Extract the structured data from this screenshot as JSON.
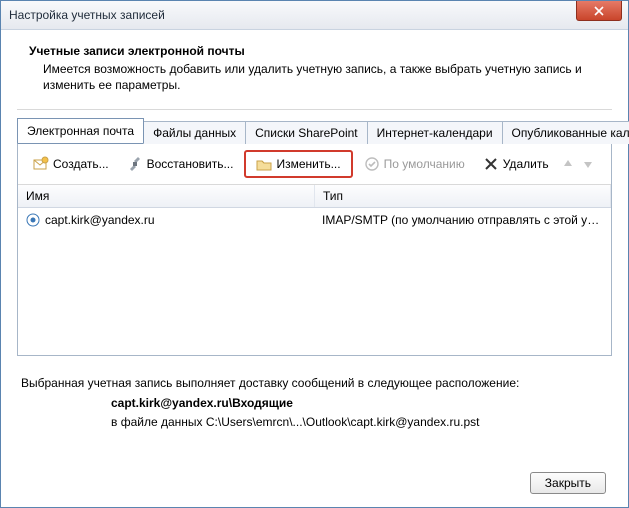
{
  "window": {
    "title": "Настройка учетных записей"
  },
  "header": {
    "title": "Учетные записи электронной почты",
    "description": "Имеется возможность добавить или удалить учетную запись, а также выбрать учетную запись и изменить ее параметры."
  },
  "tabs": [
    {
      "label": "Электронная почта",
      "active": true
    },
    {
      "label": "Файлы данных"
    },
    {
      "label": "Списки SharePoint"
    },
    {
      "label": "Интернет-календари"
    },
    {
      "label": "Опубликованные календари"
    }
  ],
  "toolbar": {
    "create": "Создать...",
    "restore": "Восстановить...",
    "edit": "Изменить...",
    "default": "По умолчанию",
    "delete": "Удалить"
  },
  "columns": {
    "name": "Имя",
    "type": "Тип"
  },
  "rows": [
    {
      "name": "capt.kirk@yandex.ru",
      "type": "IMAP/SMTP (по умолчанию отправлять с этой уче..."
    }
  ],
  "delivery": {
    "intro": "Выбранная учетная запись выполняет доставку сообщений в следующее расположение:",
    "target": "capt.kirk@yandex.ru\\Входящие",
    "path": "в файле данных C:\\Users\\emrcn\\...\\Outlook\\capt.kirk@yandex.ru.pst"
  },
  "buttons": {
    "close": "Закрыть"
  }
}
